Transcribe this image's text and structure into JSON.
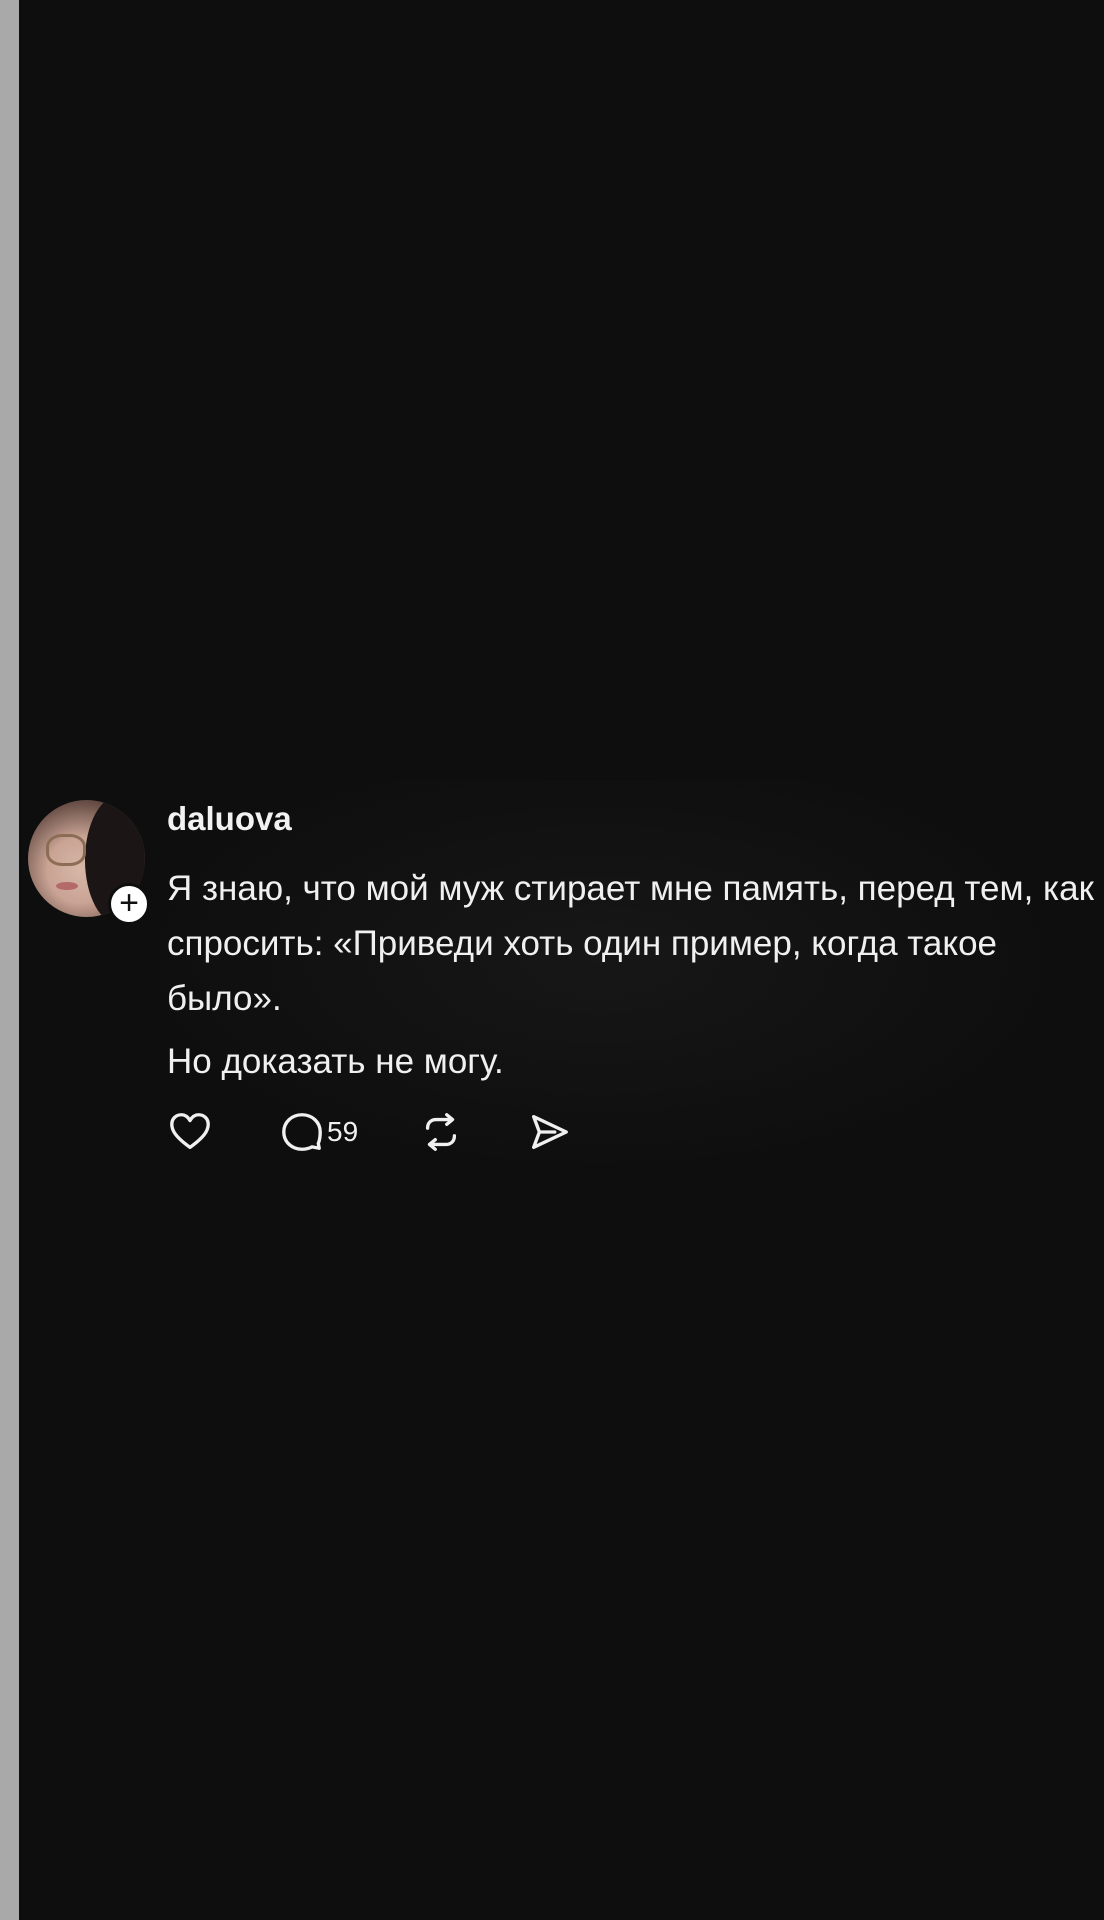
{
  "post": {
    "username": "daluova",
    "paragraphs": [
      "Я знаю, что мой муж стирает мне память, перед тем, как спросить: «Приведи хоть один пример, когда такое было».",
      "Но доказать не могу."
    ],
    "follow_badge": "+",
    "actions": {
      "reply_count": "59"
    }
  },
  "icons": {
    "like": "heart-icon",
    "reply": "comment-bubble-icon",
    "repost": "repost-icon",
    "share": "send-icon",
    "follow": "plus-icon"
  },
  "colors": {
    "background": "#0e0e0e",
    "text": "#f0f0f0",
    "left_strip": "#a9a9a9"
  }
}
